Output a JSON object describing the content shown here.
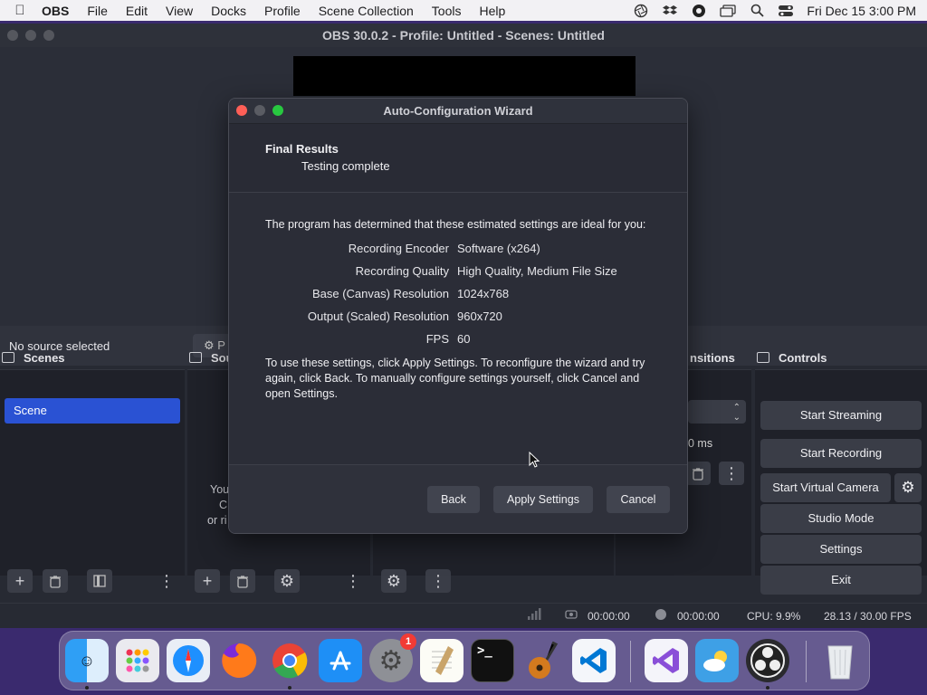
{
  "menubar": {
    "app": "OBS",
    "items": [
      "File",
      "Edit",
      "View",
      "Docks",
      "Profile",
      "Scene Collection",
      "Tools",
      "Help"
    ],
    "clock": "Fri Dec 15  3:00 PM"
  },
  "window": {
    "title": "OBS 30.0.2 - Profile: Untitled - Scenes: Untitled"
  },
  "source_bar": {
    "no_source": "No source selected",
    "properties_label": "P"
  },
  "docks": {
    "scenes_title": "Scenes",
    "sources_title": "Sou",
    "transitions_title": "nsitions",
    "controls_title": "Controls",
    "scene_items": [
      "Scene"
    ],
    "sources_hint_1": "You",
    "sources_hint_2": "C",
    "sources_hint_3": "or ri",
    "transition_duration": "0 ms"
  },
  "controls": {
    "start_streaming": "Start Streaming",
    "start_recording": "Start Recording",
    "start_virtual_camera": "Start Virtual Camera",
    "studio_mode": "Studio Mode",
    "settings": "Settings",
    "exit": "Exit"
  },
  "status": {
    "stream_time": "00:00:00",
    "rec_time": "00:00:00",
    "cpu": "CPU: 9.9%",
    "fps": "28.13 / 30.00 FPS"
  },
  "dialog": {
    "title": "Auto-Configuration Wizard",
    "heading": "Final Results",
    "subheading": "Testing complete",
    "intro": "The program has determined that these estimated settings are ideal for you:",
    "settings": [
      {
        "label": "Recording Encoder",
        "value": "Software (x264)"
      },
      {
        "label": "Recording Quality",
        "value": "High Quality, Medium File Size"
      },
      {
        "label": "Base (Canvas) Resolution",
        "value": "1024x768"
      },
      {
        "label": "Output (Scaled) Resolution",
        "value": "960x720"
      },
      {
        "label": "FPS",
        "value": "60"
      }
    ],
    "instructions_1": "To use these settings, click Apply Settings. To reconfigure the wizard and try",
    "instructions_2": "again, click Back. To manually configure settings yourself, click Cancel and",
    "instructions_3": "open Settings.",
    "back": "Back",
    "apply": "Apply Settings",
    "cancel": "Cancel"
  },
  "dock_apps": {
    "settings_badge": "1"
  }
}
